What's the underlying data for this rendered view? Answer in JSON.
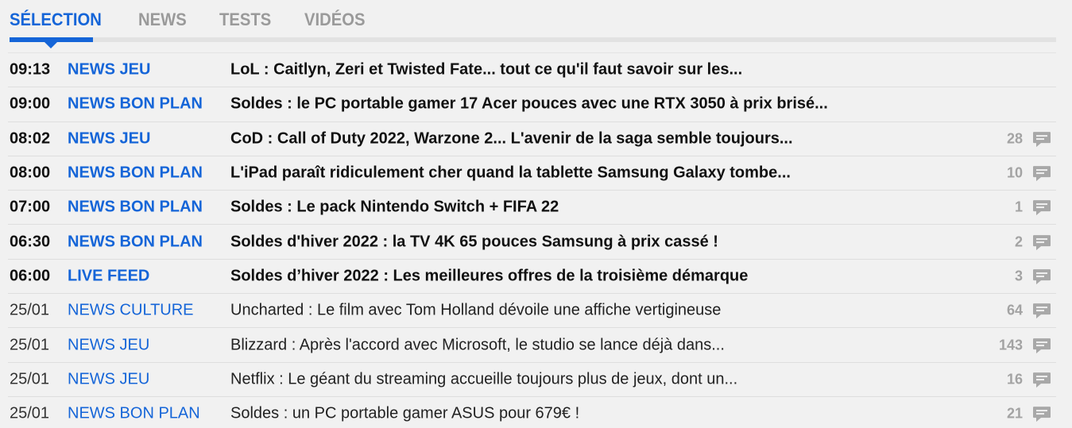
{
  "tabs": [
    {
      "label": "SÉLECTION",
      "active": true
    },
    {
      "label": "NEWS",
      "active": false
    },
    {
      "label": "TESTS",
      "active": false
    },
    {
      "label": "VIDÉOS",
      "active": false
    }
  ],
  "colors": {
    "accent": "#1565d8",
    "muted": "#9a9a9a",
    "background": "#f1f1f1"
  },
  "articles": [
    {
      "time": "09:13",
      "category": "NEWS JEU",
      "title": "LoL : Caitlyn, Zeri et Twisted Fate... tout ce qu'il faut savoir sur les...",
      "comments": "",
      "bold": true
    },
    {
      "time": "09:00",
      "category": "NEWS BON PLAN",
      "title": "Soldes : le PC portable gamer 17 Acer pouces avec une RTX 3050 à prix brisé...",
      "comments": "",
      "bold": true
    },
    {
      "time": "08:02",
      "category": "NEWS JEU",
      "title": "CoD : Call of Duty 2022, Warzone 2... L'avenir de la saga semble toujours...",
      "comments": "28",
      "bold": true
    },
    {
      "time": "08:00",
      "category": "NEWS BON PLAN",
      "title": "L'iPad paraît ridiculement cher quand la tablette Samsung Galaxy tombe...",
      "comments": "10",
      "bold": true
    },
    {
      "time": "07:00",
      "category": "NEWS BON PLAN",
      "title": "Soldes : Le pack Nintendo Switch + FIFA 22",
      "comments": "1",
      "bold": true
    },
    {
      "time": "06:30",
      "category": "NEWS BON PLAN",
      "title": "Soldes d'hiver 2022 : la TV 4K 65 pouces Samsung à prix cassé !",
      "comments": "2",
      "bold": true
    },
    {
      "time": "06:00",
      "category": "LIVE FEED",
      "title": "Soldes d’hiver 2022 : Les meilleures offres de la troisième démarque",
      "comments": "3",
      "bold": true
    },
    {
      "time": "25/01",
      "category": "NEWS CULTURE",
      "title": "Uncharted : Le film avec Tom Holland dévoile une affiche vertigineuse",
      "comments": "64",
      "bold": false
    },
    {
      "time": "25/01",
      "category": "NEWS JEU",
      "title": "Blizzard : Après l'accord avec Microsoft, le studio se lance déjà dans...",
      "comments": "143",
      "bold": false
    },
    {
      "time": "25/01",
      "category": "NEWS JEU",
      "title": "Netflix : Le géant du streaming accueille toujours plus de jeux, dont un...",
      "comments": "16",
      "bold": false
    },
    {
      "time": "25/01",
      "category": "NEWS BON PLAN",
      "title": "Soldes : un PC portable gamer ASUS pour 679€ !",
      "comments": "21",
      "bold": false
    }
  ],
  "icons": {
    "comment": "comment-bubble-icon"
  }
}
